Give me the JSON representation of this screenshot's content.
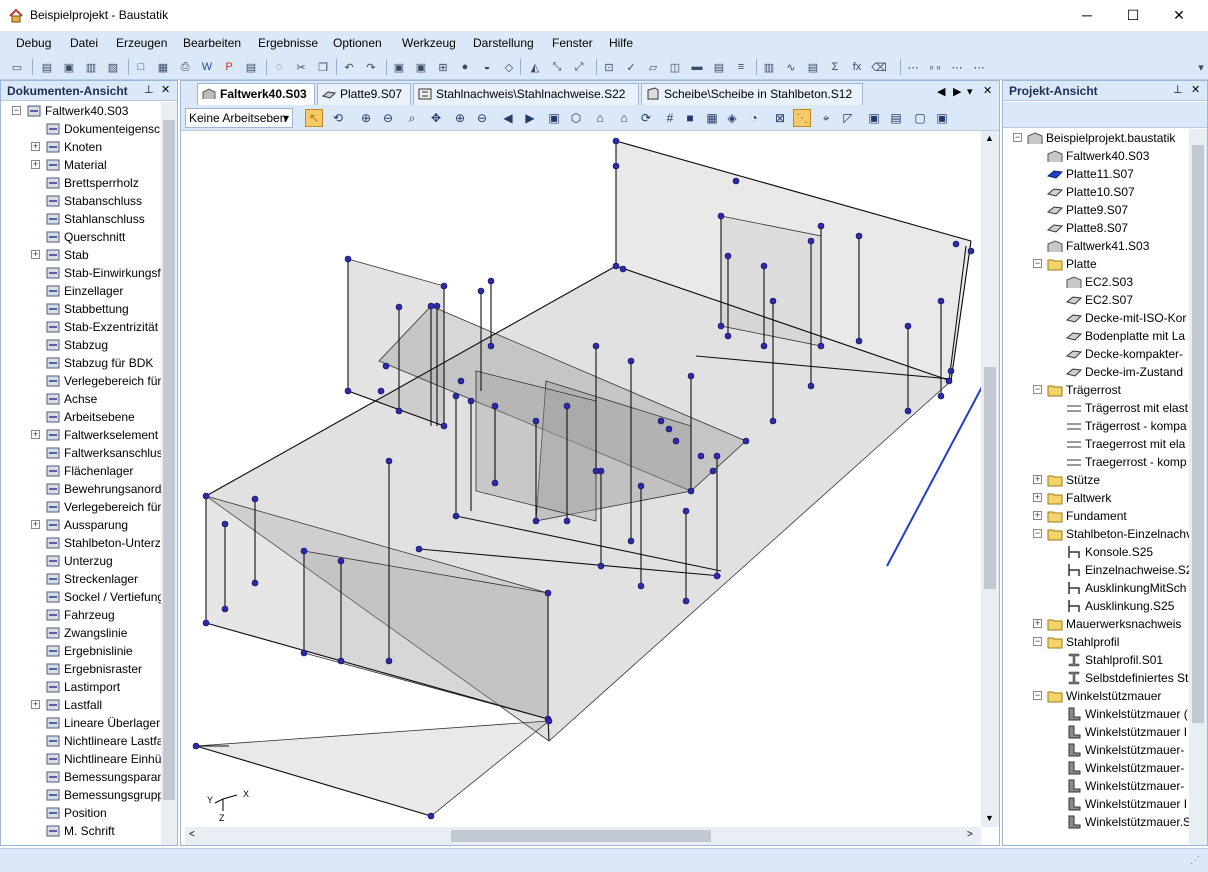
{
  "window": {
    "title": "Beispielprojekt - Baustatik",
    "minimize_glyph": "─",
    "maximize_glyph": "☐",
    "close_glyph": "✕"
  },
  "menu": [
    "Debug",
    "Datei",
    "Erzeugen",
    "Bearbeiten",
    "Ergebnisse",
    "Optionen",
    "Werkzeug",
    "Darstellung",
    "Fenster",
    "Hilfe"
  ],
  "left_panel": {
    "title": "Dokumenten-Ansicht",
    "root": "Faltwerk40.S03",
    "items": [
      {
        "label": "Dokumenteigensc",
        "icon": "document-icon",
        "expandable": false
      },
      {
        "label": "Knoten",
        "icon": "node-icon",
        "expandable": true
      },
      {
        "label": "Material",
        "icon": "material-icon",
        "expandable": true
      },
      {
        "label": "Brettsperrholz",
        "icon": "clt-icon",
        "expandable": false
      },
      {
        "label": "Stabanschluss",
        "icon": "bar-connection-icon",
        "expandable": false
      },
      {
        "label": "Stahlanschluss",
        "icon": "steel-connection-icon",
        "expandable": false
      },
      {
        "label": "Querschnitt",
        "icon": "cross-section-icon",
        "expandable": false
      },
      {
        "label": "Stab",
        "icon": "bar-icon",
        "expandable": true
      },
      {
        "label": "Stab-Einwirkungsf",
        "icon": "bar-action-icon",
        "expandable": false
      },
      {
        "label": "Einzellager",
        "icon": "support-icon",
        "expandable": false
      },
      {
        "label": "Stabbettung",
        "icon": "bar-bedding-icon",
        "expandable": false
      },
      {
        "label": "Stab-Exzentrizität",
        "icon": "eccentricity-icon",
        "expandable": false
      },
      {
        "label": "Stabzug",
        "icon": "bar-chain-icon",
        "expandable": false
      },
      {
        "label": "Stabzug für BDK",
        "icon": "bar-chain-bdk-icon",
        "expandable": false
      },
      {
        "label": "Verlegebereich für",
        "icon": "laying-area-icon",
        "expandable": false
      },
      {
        "label": "Achse",
        "icon": "axis-icon",
        "expandable": false
      },
      {
        "label": "Arbeitsebene",
        "icon": "work-plane-icon",
        "expandable": false
      },
      {
        "label": "Faltwerkselement",
        "icon": "folded-plate-element-icon",
        "expandable": true
      },
      {
        "label": "Faltwerksanschlus",
        "icon": "folded-plate-connection-icon",
        "expandable": false
      },
      {
        "label": "Flächenlager",
        "icon": "area-support-icon",
        "expandable": false
      },
      {
        "label": "Bewehrungsanord",
        "icon": "reinforcement-icon",
        "expandable": false
      },
      {
        "label": "Verlegebereich für",
        "icon": "laying-area-icon",
        "expandable": false
      },
      {
        "label": "Aussparung",
        "icon": "opening-icon",
        "expandable": true
      },
      {
        "label": "Stahlbeton-Unterz",
        "icon": "rc-beam-icon",
        "expandable": false
      },
      {
        "label": "Unterzug",
        "icon": "beam-icon",
        "expandable": false
      },
      {
        "label": "Streckenlager",
        "icon": "line-support-icon",
        "expandable": false
      },
      {
        "label": "Sockel / Vertiefung",
        "icon": "plinth-icon",
        "expandable": false
      },
      {
        "label": "Fahrzeug",
        "icon": "vehicle-icon",
        "expandable": false
      },
      {
        "label": "Zwangslinie",
        "icon": "constraint-line-icon",
        "expandable": false
      },
      {
        "label": "Ergebnislinie",
        "icon": "result-line-icon",
        "expandable": false
      },
      {
        "label": "Ergebnisraster",
        "icon": "result-grid-icon",
        "expandable": false
      },
      {
        "label": "Lastimport",
        "icon": "load-import-icon",
        "expandable": false
      },
      {
        "label": "Lastfall",
        "icon": "load-case-icon",
        "expandable": true
      },
      {
        "label": "Lineare Überlagerı",
        "icon": "linear-superposition-icon",
        "expandable": false
      },
      {
        "label": "Nichtlineare Lastfa",
        "icon": "nonlinear-load-icon",
        "expandable": false
      },
      {
        "label": "Nichtlineare Einhü",
        "icon": "nonlinear-envelope-icon",
        "expandable": false
      },
      {
        "label": "Bemessungsparan",
        "icon": "design-params-icon",
        "expandable": false
      },
      {
        "label": "Bemessungsgrupp",
        "icon": "design-group-icon",
        "expandable": false
      },
      {
        "label": "Position",
        "icon": "position-icon",
        "expandable": false
      },
      {
        "label": "M. Schrift",
        "icon": "text-icon",
        "expandable": false
      }
    ]
  },
  "tabs": [
    {
      "label": "Faltwerk40.S03",
      "icon": "folded-plate-icon",
      "active": true
    },
    {
      "label": "Platte9.S07",
      "icon": "plate-icon",
      "active": false
    },
    {
      "label": "Stahlnachweis\\Stahlnachweise.S22",
      "icon": "steel-check-icon",
      "active": false
    },
    {
      "label": "Scheibe\\Scheibe in Stahlbeton.S12",
      "icon": "wall-plate-icon",
      "active": false
    }
  ],
  "view_toolbar": {
    "work_plane_select": "Keine Arbeitseben"
  },
  "axis_indicator": {
    "y": "Y",
    "x": "X",
    "z": "Z"
  },
  "right_panel": {
    "title": "Projekt-Ansicht",
    "root": "Beispielprojekt.baustatik",
    "items": [
      {
        "label": "Faltwerk40.S03",
        "icon": "folded-plate-icon",
        "level": 1
      },
      {
        "label": "Platte11.S07",
        "icon": "plate-selected-icon",
        "level": 1
      },
      {
        "label": "Platte10.S07",
        "icon": "plate-icon",
        "level": 1
      },
      {
        "label": "Platte9.S07",
        "icon": "plate-icon",
        "level": 1
      },
      {
        "label": "Platte8.S07",
        "icon": "plate-icon",
        "level": 1
      },
      {
        "label": "Faltwerk41.S03",
        "icon": "folded-plate-icon",
        "level": 1
      },
      {
        "label": "Platte",
        "icon": "folder-icon",
        "level": 1,
        "expander": "minus"
      },
      {
        "label": "EC2.S03",
        "icon": "folded-plate-icon",
        "level": 2
      },
      {
        "label": "EC2.S07",
        "icon": "plate-icon",
        "level": 2
      },
      {
        "label": "Decke-mit-ISO-Kor",
        "icon": "plate-icon",
        "level": 2
      },
      {
        "label": "Bodenplatte mit La",
        "icon": "plate-icon",
        "level": 2
      },
      {
        "label": "Decke-kompakter-",
        "icon": "plate-icon",
        "level": 2
      },
      {
        "label": "Decke-im-Zustand",
        "icon": "plate-icon",
        "level": 2
      },
      {
        "label": "Trägerrost",
        "icon": "folder-icon",
        "level": 1,
        "expander": "minus"
      },
      {
        "label": "Trägerrost mit elast",
        "icon": "grillage-icon",
        "level": 2
      },
      {
        "label": "Trägerrost - kompa",
        "icon": "grillage-icon",
        "level": 2
      },
      {
        "label": "Traegerrost mit ela",
        "icon": "grillage-icon",
        "level": 2
      },
      {
        "label": "Traegerrost - komp",
        "icon": "grillage-icon",
        "level": 2
      },
      {
        "label": "Stütze",
        "icon": "folder-icon",
        "level": 1,
        "expander": "plus"
      },
      {
        "label": "Faltwerk",
        "icon": "folder-icon",
        "level": 1,
        "expander": "plus"
      },
      {
        "label": "Fundament",
        "icon": "folder-icon",
        "level": 1,
        "expander": "plus"
      },
      {
        "label": "Stahlbeton-Einzelnachv",
        "icon": "folder-icon",
        "level": 1,
        "expander": "minus"
      },
      {
        "label": "Konsole.S25",
        "icon": "rc-check-icon",
        "level": 2
      },
      {
        "label": "Einzelnachweise.S2",
        "icon": "rc-check-icon",
        "level": 2
      },
      {
        "label": "AusklinkungMitSch",
        "icon": "rc-check-icon",
        "level": 2
      },
      {
        "label": "Ausklinkung.S25",
        "icon": "rc-check-icon",
        "level": 2
      },
      {
        "label": "Mauerwerksnachweis",
        "icon": "folder-icon",
        "level": 1,
        "expander": "plus"
      },
      {
        "label": "Stahlprofil",
        "icon": "folder-icon",
        "level": 1,
        "expander": "minus"
      },
      {
        "label": "Stahlprofil.S01",
        "icon": "steel-profile-icon",
        "level": 2
      },
      {
        "label": "Selbstdefiniertes St",
        "icon": "steel-profile-icon",
        "level": 2
      },
      {
        "label": "Winkelstützmauer",
        "icon": "folder-icon",
        "level": 1,
        "expander": "minus"
      },
      {
        "label": "Winkelstützmauer (",
        "icon": "retaining-wall-icon",
        "level": 2
      },
      {
        "label": "Winkelstützmauer I",
        "icon": "retaining-wall-icon",
        "level": 2
      },
      {
        "label": "Winkelstützmauer-",
        "icon": "retaining-wall-icon",
        "level": 2
      },
      {
        "label": "Winkelstützmauer-",
        "icon": "retaining-wall-icon",
        "level": 2
      },
      {
        "label": "Winkelstützmauer-",
        "icon": "retaining-wall-icon",
        "level": 2
      },
      {
        "label": "Winkelstützmauer I",
        "icon": "retaining-wall-icon",
        "level": 2
      },
      {
        "label": "Winkelstützmauer.S",
        "icon": "retaining-wall-icon",
        "level": 2
      }
    ]
  },
  "colors": {
    "chrome": "#dbe8f7",
    "node": "#2c2ca8",
    "plate_fill": "#9c9c9c",
    "annotation_line": "#1f3fc4"
  }
}
